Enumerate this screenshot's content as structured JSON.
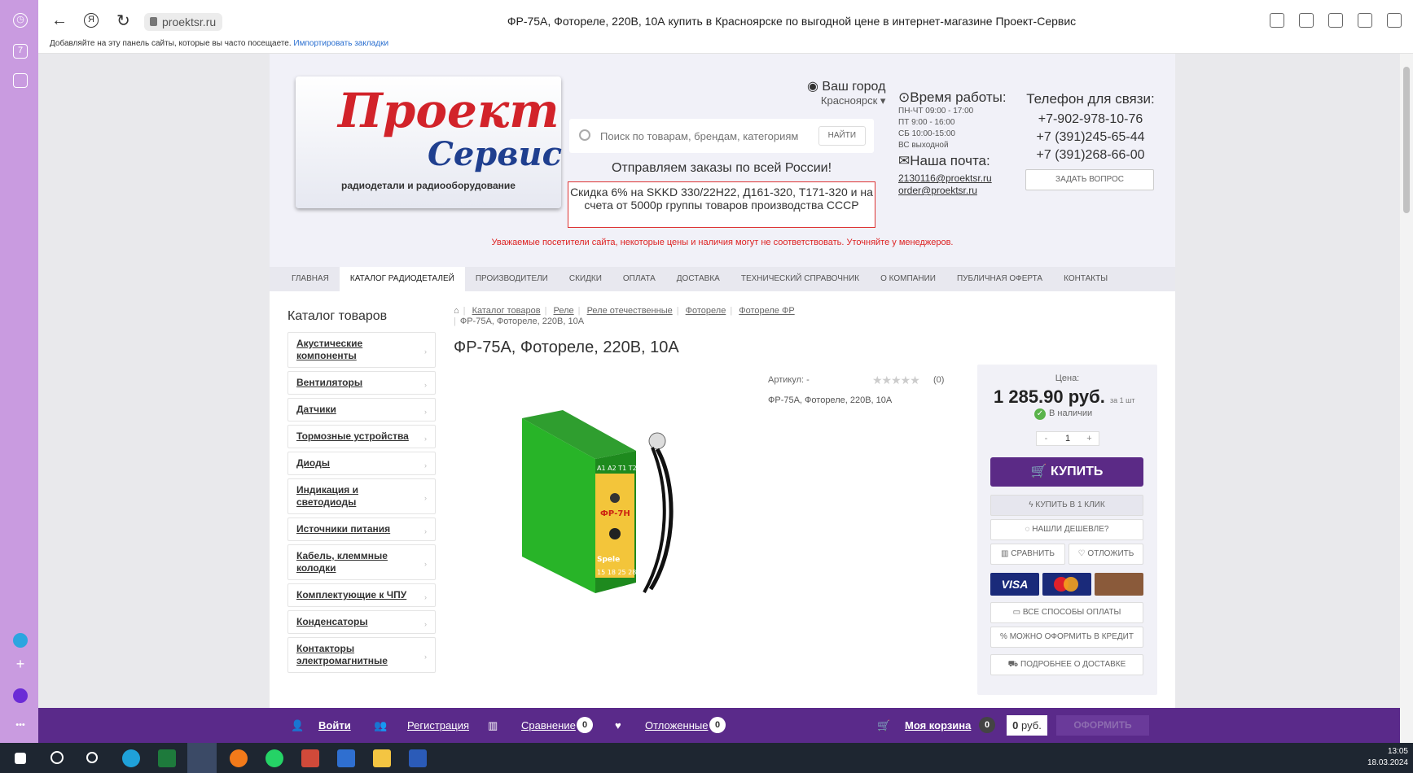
{
  "browser": {
    "url": "proektsr.ru",
    "title": "ФР-75А, Фотореле, 220В, 10А купить в Красноярске по выгодной цене в интернет-магазине Проект-Сервис",
    "bookmarks_hint": "Добавляйте на эту панель сайты, которые вы часто посещаете.",
    "bookmarks_link": "Импортировать закладки",
    "yandex_glyph": "Я",
    "sidebar_badge": "7"
  },
  "header": {
    "logo_line1": "Проект",
    "logo_line2": "Сервис",
    "logo_tagline": "радиодетали и радиооборудование",
    "city_label": "Ваш город",
    "city_value": "Красноярск ▾",
    "search_placeholder": "Поиск по товарам, брендам, категориям",
    "search_button": "НАЙТИ",
    "shipping_text": "Отправляем заказы по всей России!",
    "promo_text": "Скидка 6% на SKKD 330/22H22, Д161-320, Т171-320 и на счета от 5000р группы товаров производства СССР",
    "hours_title": "Время работы:",
    "hours": [
      "ПН-ЧТ 09:00 - 17:00",
      "ПТ 9:00 - 16:00",
      "СБ 10:00-15:00",
      "ВС выходной"
    ],
    "mail_title": "Наша почта:",
    "emails": [
      "2130116@proektsr.ru",
      "order@proektsr.ru"
    ],
    "phones_title": "Телефон для связи:",
    "phones": [
      "+7-902-978-10-76",
      "+7 (391)245-65-44",
      "+7 (391)268-66-00"
    ],
    "ask_button": "ЗАДАТЬ ВОПРОС",
    "notice": "Уважаемые посетители сайта, некоторые цены и наличия могут не соответствовать. Уточняйте у менеджеров."
  },
  "menu": [
    "ГЛАВНАЯ",
    "КАТАЛОГ РАДИОДЕТАЛЕЙ",
    "ПРОИЗВОДИТЕЛИ",
    "СКИДКИ",
    "ОПЛАТА",
    "ДОСТАВКА",
    "ТЕХНИЧЕСКИЙ СПРАВОЧНИК",
    "О КОМПАНИИ",
    "ПУБЛИЧНАЯ ОФЕРТА",
    "КОНТАКТЫ"
  ],
  "catalog": {
    "title": "Каталог товаров",
    "items": [
      "Акустические компоненты",
      "Вентиляторы",
      "Датчики",
      "Тормозные устройства",
      "Диоды",
      "Индикация и светодиоды",
      "Источники питания",
      "Кабель, клеммные колодки",
      "Комплектующие к ЧПУ",
      "Конденсаторы",
      "Контакторы электромагнитные"
    ]
  },
  "breadcrumb": [
    "Каталог товаров",
    "Реле",
    "Реле отечественные",
    "Фотореле",
    "Фотореле ФР"
  ],
  "breadcrumb_current": "ФР-75А, Фотореле, 220В, 10А",
  "product": {
    "title": "ФР-75А, Фотореле, 220В, 10А",
    "sku": "Артикул: -",
    "stars": "★★★★★",
    "rating": 0,
    "reviews": "(0)",
    "short_desc": "ФР-75А, Фотореле, 220В, 10А",
    "image_label": "ФР-7Н",
    "image_brand": "Spele",
    "terminals_top": "A1 A2 T1 T2",
    "terminals_bottom": "15 18 25 28"
  },
  "buybox": {
    "price_label": "Цена:",
    "price": "1 285.90 руб.",
    "per_unit": "за 1 шт",
    "stock": "В наличии",
    "qty_minus": "-",
    "qty": "1",
    "qty_plus": "+",
    "buy": "КУПИТЬ",
    "one_click": "КУПИТЬ В 1 КЛИК",
    "cheaper": "НАШЛИ ДЕШЕВЛЕ?",
    "compare": "СРАВНИТЬ",
    "defer": "ОТЛОЖИТЬ",
    "visa": "VISA",
    "pay_methods": "ВСЕ СПОСОБЫ ОПЛАТЫ",
    "credit": "МОЖНО ОФОРМИТЬ В КРЕДИТ",
    "delivery": "ПОДРОБНЕЕ О ДОСТАВКЕ"
  },
  "bottom_bar": {
    "login": "Войти",
    "register": "Регистрация",
    "compare": "Сравнение",
    "compare_count": "0",
    "deferred": "Отложенные",
    "deferred_count": "0",
    "cart": "Моя корзина",
    "cart_count": "0",
    "cart_sum": "0",
    "currency": "руб.",
    "checkout": "ОФОРМИТЬ"
  },
  "taskbar": {
    "time": "13:05",
    "date": "18.03.2024"
  },
  "colors": {
    "brand_purple": "#5b2a86",
    "bottom_bar": "#5a2a8a",
    "sidebar": "#c99be0",
    "logo_red": "#d2232a",
    "logo_blue": "#1f3f8f",
    "notice_red": "#dd2222"
  }
}
